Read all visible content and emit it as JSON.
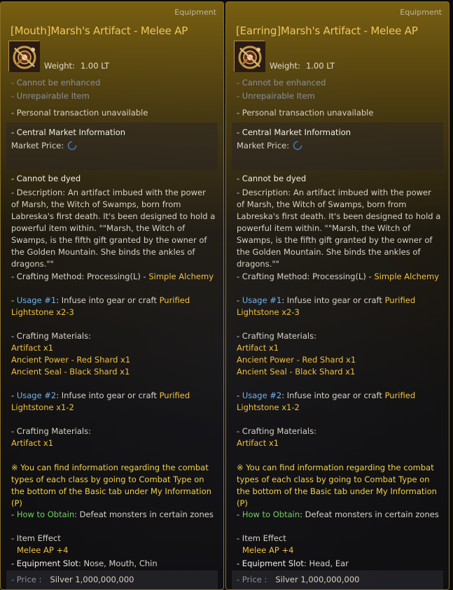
{
  "tooltips": [
    {
      "category": "Equipment",
      "title": "[Mouth]Marsh's Artifact - Melee AP",
      "weight_label": "Weight:",
      "weight_value": "1.00 LT",
      "cannot_enhance": "- Cannot be enhanced",
      "unrepairable": "- Unrepairable Item",
      "personal_trade": "- Personal transaction unavailable",
      "market_header": "- Central Market Information",
      "market_price_label": "Market Price:",
      "cannot_dye": "- Cannot be dyed",
      "description": "- Description: An artifact imbued with the power of Marsh, the Witch of Swamps, born from Labreska's first death. It's been designed to hold a powerful item within. \"\"Marsh, the Witch of Swamps, is the fifth gift granted by the owner of the Golden Mountain. She binds the ankles of dragons.\"\"",
      "crafting_method_prefix": "- Crafting Method: Processing(L) - ",
      "crafting_method_value": "Simple Alchemy",
      "usage1_label": "Usage #1",
      "usage1_text": ": Infuse into gear or craft ",
      "usage1_item_a": "Purified",
      "usage1_item_b": "Lightstone x2-3",
      "materials1_label": "- Crafting Materials:",
      "materials1": [
        "Artifact x1",
        "Ancient Power - Red Shard x1",
        "Ancient Seal - Black Shard x1"
      ],
      "usage2_label": "Usage #2",
      "usage2_text": ": Infuse into gear or craft ",
      "usage2_item_a": "Purified",
      "usage2_item_b": "Lightstone x1-2",
      "materials2_label": "- Crafting Materials:",
      "materials2": [
        "Artifact x1"
      ],
      "combat_note": "※ You can find information regarding the combat types of each class by going to Combat Type on the bottom of the Basic tab under My Information (P)",
      "obtain_prefix": "- ",
      "obtain_label": "How to Obtain",
      "obtain_text": ": Defeat monsters in certain zones",
      "item_effect_label": "- Item Effect",
      "item_effect_value": "Melee AP +4",
      "slot_label": "- Equipment Slot",
      "slot_value": ": Nose, Mouth, Chin",
      "price_label": "- Price :",
      "price_value": "Silver 1,000,000,000"
    },
    {
      "category": "Equipment",
      "title": "[Earring]Marsh's Artifact - Melee AP",
      "weight_label": "Weight:",
      "weight_value": "1.00 LT",
      "cannot_enhance": "- Cannot be enhanced",
      "unrepairable": "- Unrepairable Item",
      "personal_trade": "- Personal transaction unavailable",
      "market_header": "- Central Market Information",
      "market_price_label": "Market Price:",
      "cannot_dye": "- Cannot be dyed",
      "description": "- Description: An artifact imbued with the power of Marsh, the Witch of Swamps, born from Labreska's first death. It's been designed to hold a powerful item within. \"\"Marsh, the Witch of Swamps, is the fifth gift granted by the owner of the Golden Mountain. She binds the ankles of dragons.\"\"",
      "crafting_method_prefix": "- Crafting Method: Processing(L) - ",
      "crafting_method_value": "Simple Alchemy",
      "usage1_label": "Usage #1",
      "usage1_text": ": Infuse into gear or craft ",
      "usage1_item_a": "Purified",
      "usage1_item_b": "Lightstone x2-3",
      "materials1_label": "- Crafting Materials:",
      "materials1": [
        "Artifact x1",
        "Ancient Power - Red Shard x1",
        "Ancient Seal - Black Shard x1"
      ],
      "usage2_label": "Usage #2",
      "usage2_text": ": Infuse into gear or craft ",
      "usage2_item_a": "Purified",
      "usage2_item_b": "Lightstone x1-2",
      "materials2_label": "- Crafting Materials:",
      "materials2": [
        "Artifact x1"
      ],
      "combat_note": "※ You can find information regarding the combat types of each class by going to Combat Type on the bottom of the Basic tab under My Information (P)",
      "obtain_prefix": "- ",
      "obtain_label": "How to Obtain",
      "obtain_text": ": Defeat monsters in certain zones",
      "item_effect_label": "- Item Effect",
      "item_effect_value": "Melee AP +4",
      "slot_label": "- Equipment Slot",
      "slot_value": ": Head, Ear",
      "price_label": "- Price :",
      "price_value": "Silver 1,000,000,000"
    }
  ],
  "colors": {
    "title": "#f1c85a",
    "accent_gold": "#f0c040",
    "usage_blue": "#6fb3f0",
    "obtain_green": "#72d060",
    "muted": "#8a8fa0"
  },
  "icons": {
    "item": "artifact-item-icon",
    "loading": "loading-spinner-icon"
  }
}
